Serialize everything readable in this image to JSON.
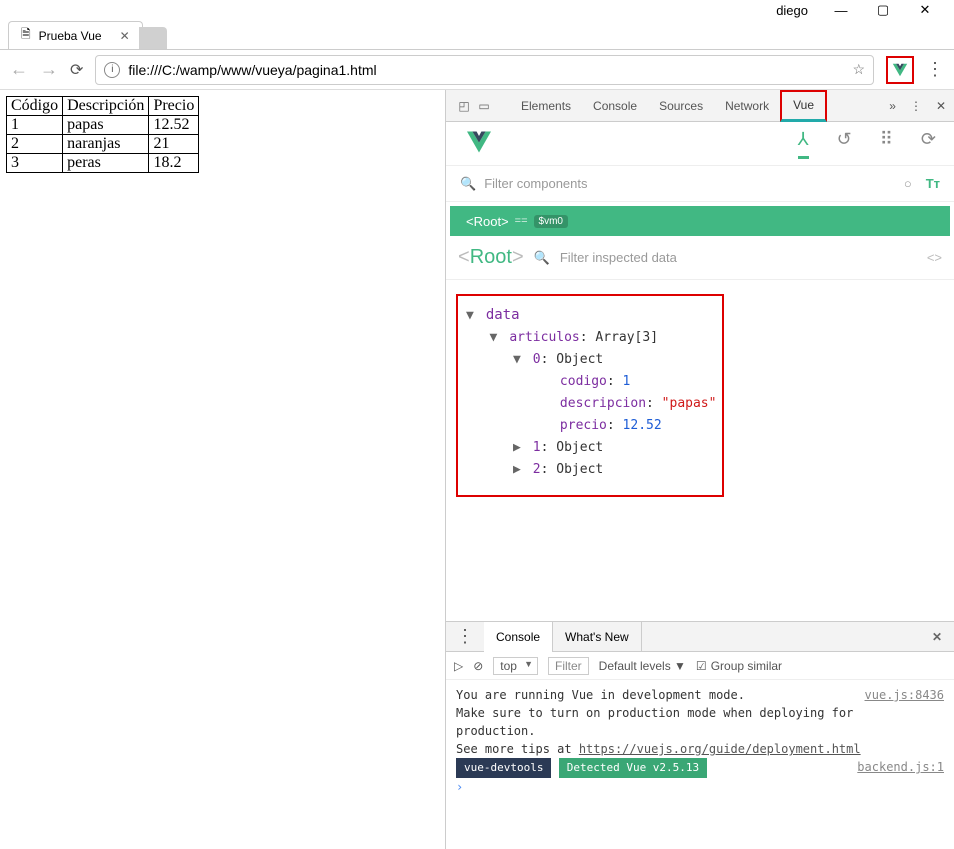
{
  "window": {
    "user": "diego"
  },
  "tab": {
    "title": "Prueba Vue"
  },
  "address": {
    "url": "file:///C:/wamp/www/vueya/pagina1.html"
  },
  "table": {
    "headers": [
      "Código",
      "Descripción",
      "Precio"
    ],
    "rows": [
      [
        "1",
        "papas",
        "12.52"
      ],
      [
        "2",
        "naranjas",
        "21"
      ],
      [
        "3",
        "peras",
        "18.2"
      ]
    ]
  },
  "devtools": {
    "tabs": [
      "Elements",
      "Console",
      "Sources",
      "Network",
      "Vue"
    ],
    "active": "Vue"
  },
  "vue": {
    "filter_placeholder": "Filter components",
    "root_label": "<Root>",
    "root_eq": "==",
    "root_vm": "$vm0",
    "inspect_root": "Root",
    "inspect_filter": "Filter inspected data",
    "data_label": "data",
    "arr_label": "articulos",
    "arr_type": "Array[3]",
    "obj0": {
      "label": "0",
      "type": "Object",
      "codigo_k": "codigo",
      "codigo_v": "1",
      "desc_k": "descripcion",
      "desc_v": "\"papas\"",
      "precio_k": "precio",
      "precio_v": "12.52"
    },
    "obj1": {
      "label": "1",
      "type": "Object"
    },
    "obj2": {
      "label": "2",
      "type": "Object"
    }
  },
  "drawer": {
    "tabs": [
      "Console",
      "What's New"
    ],
    "context": "top",
    "filter": "Filter",
    "levels": "Default levels",
    "group": "Group similar",
    "lines": {
      "l1": "You are running Vue in development mode.",
      "l1_src": "vue.js:8436",
      "l2": "Make sure to turn on production mode when deploying for",
      "l3": "production.",
      "l4a": "See more tips at ",
      "l4b": "https://vuejs.org/guide/deployment.html",
      "badge1": "vue-devtools",
      "badge2": "Detected Vue v2.5.13",
      "badge_src": "backend.js:1"
    }
  }
}
